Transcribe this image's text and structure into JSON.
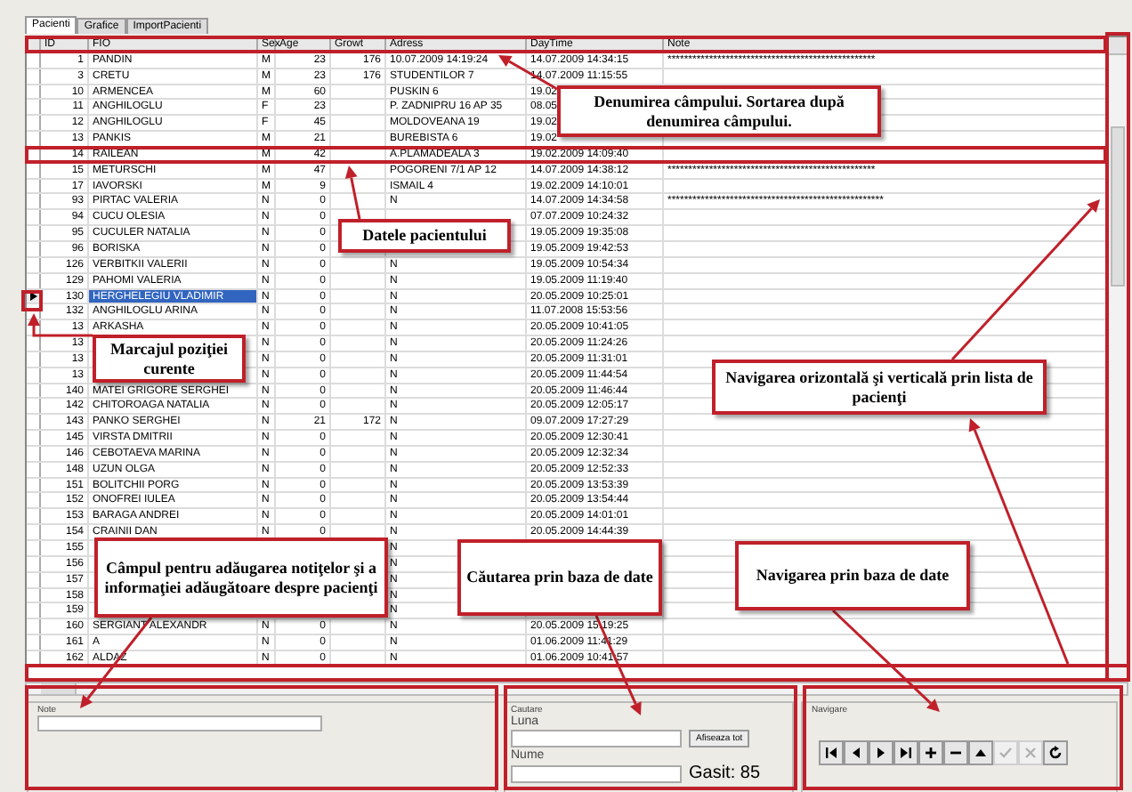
{
  "tabs": [
    {
      "label": "Pacienti",
      "selected": true
    },
    {
      "label": "Grafice",
      "selected": false
    },
    {
      "label": "ImportPacienti",
      "selected": false
    }
  ],
  "grid": {
    "columns": [
      "ID",
      "FIO",
      "Sex",
      "Age",
      "Growt",
      "Adress",
      "DayTime",
      "Note"
    ],
    "rows": [
      {
        "id": "1",
        "fio": "PANDIN",
        "sex": "M",
        "age": "23",
        "growth": "176",
        "address": "10.07.2009 14:19:24",
        "daytime": "14.07.2009 14:34:15",
        "note": "**************************************************",
        "selected": false,
        "current": false
      },
      {
        "id": "3",
        "fio": "CRETU",
        "sex": "M",
        "age": "23",
        "growth": "176",
        "address": "STUDENTILOR 7",
        "daytime": "14.07.2009 11:15:55",
        "selected": false,
        "current": false
      },
      {
        "id": "10",
        "fio": "ARMENCEA",
        "sex": "M",
        "age": "60",
        "address": "PUSKIN 6",
        "daytime": "19.02",
        "selected": false,
        "current": false
      },
      {
        "id": "11",
        "fio": "ANGHILOGLU",
        "sex": "F",
        "age": "23",
        "address": "P. ZADNIPRU 16 AP 35",
        "daytime": "08.05",
        "selected": false,
        "current": false
      },
      {
        "id": "12",
        "fio": "ANGHILOGLU",
        "sex": "F",
        "age": "45",
        "address": "MOLDOVEANA 19",
        "daytime": "19.02",
        "selected": false,
        "current": false
      },
      {
        "id": "13",
        "fio": "PANKIS",
        "sex": "M",
        "age": "21",
        "address": "BUREBISTA 6",
        "daytime": "19.02",
        "selected": false,
        "current": false
      },
      {
        "id": "14",
        "fio": "RAILEAN",
        "sex": "M",
        "age": "42",
        "address": "A.PLAMADEALA 3",
        "daytime": "19.02.2009 14:09:40",
        "selected": false,
        "current": false
      },
      {
        "id": "15",
        "fio": "METURSCHI",
        "sex": "M",
        "age": "47",
        "address": "POGORENI 7/1 AP 12",
        "daytime": "14.07.2009 14:38:12",
        "note": "**************************************************",
        "selected": false,
        "current": false
      },
      {
        "id": "17",
        "fio": "IAVORSKI",
        "sex": "M",
        "age": "9",
        "address": "ISMAIL 4",
        "daytime": "19.02.2009 14:10:01",
        "selected": false,
        "current": false
      },
      {
        "id": "93",
        "fio": "PIRTAC VALERIA",
        "sex": "N",
        "age": "0",
        "address": "N",
        "daytime": "14.07.2009 14:34:58",
        "note": "****************************************************",
        "selected": false,
        "current": false
      },
      {
        "id": "94",
        "fio": "CUCU OLESIA",
        "sex": "N",
        "age": "0",
        "daytime": "07.07.2009 10:24:32",
        "selected": false,
        "current": false
      },
      {
        "id": "95",
        "fio": "CUCULER NATALIA",
        "sex": "N",
        "age": "0",
        "daytime": "19.05.2009 19:35:08",
        "selected": false,
        "current": false
      },
      {
        "id": "96",
        "fio": "BORISKA",
        "sex": "N",
        "age": "0",
        "daytime": "19.05.2009 19:42:53",
        "selected": false,
        "current": false
      },
      {
        "id": "126",
        "fio": "VERBITKII VALERII",
        "sex": "N",
        "age": "0",
        "address": "N",
        "daytime": "19.05.2009 10:54:34",
        "selected": false,
        "current": false
      },
      {
        "id": "129",
        "fio": "PAHOMI VALERIA",
        "sex": "N",
        "age": "0",
        "address": "N",
        "daytime": "19.05.2009 11:19:40",
        "selected": false,
        "current": false
      },
      {
        "id": "130",
        "fio": "HERGHELEGIU VLADIMIR",
        "sex": "N",
        "age": "0",
        "address": "N",
        "daytime": "20.05.2009 10:25:01",
        "selected": true,
        "current": true
      },
      {
        "id": "132",
        "fio": "ANGHILOGLU ARINA",
        "sex": "N",
        "age": "0",
        "address": "N",
        "daytime": "11.07.2008 15:53:56",
        "selected": false,
        "current": false
      },
      {
        "id": "13",
        "fio": "ARKASHA",
        "sex": "N",
        "age": "0",
        "address": "N",
        "daytime": "20.05.2009 10:41:05",
        "selected": false,
        "current": false
      },
      {
        "id": "13",
        "sex": "N",
        "age": "0",
        "address": "N",
        "daytime": "20.05.2009 11:24:26",
        "selected": false,
        "current": false
      },
      {
        "id": "13",
        "sex": "N",
        "age": "0",
        "address": "N",
        "daytime": "20.05.2009 11:31:01",
        "selected": false,
        "current": false
      },
      {
        "id": "13",
        "sex": "N",
        "age": "0",
        "address": "N",
        "daytime": "20.05.2009 11:44:54",
        "selected": false,
        "current": false
      },
      {
        "id": "140",
        "fio": "MATEI GRIGORE SERGHEI",
        "sex": "N",
        "age": "0",
        "address": "N",
        "daytime": "20.05.2009 11:46:44",
        "selected": false,
        "current": false
      },
      {
        "id": "142",
        "fio": "CHITOROAGA NATALIA",
        "sex": "N",
        "age": "0",
        "address": "N",
        "daytime": "20.05.2009 12:05:17",
        "selected": false,
        "current": false
      },
      {
        "id": "143",
        "fio": "PANKO SERGHEI",
        "sex": "N",
        "age": "21",
        "growth": "172",
        "address": "N",
        "daytime": "09.07.2009 17:27:29",
        "selected": false,
        "current": false
      },
      {
        "id": "145",
        "fio": "VIRSTA DMITRII",
        "sex": "N",
        "age": "0",
        "address": "N",
        "daytime": "20.05.2009 12:30:41",
        "selected": false,
        "current": false
      },
      {
        "id": "146",
        "fio": "CEBOTAEVA MARINA",
        "sex": "N",
        "age": "0",
        "address": "N",
        "daytime": "20.05.2009 12:32:34",
        "selected": false,
        "current": false
      },
      {
        "id": "148",
        "fio": "UZUN OLGA",
        "sex": "N",
        "age": "0",
        "address": "N",
        "daytime": "20.05.2009 12:52:33",
        "selected": false,
        "current": false
      },
      {
        "id": "151",
        "fio": "BOLITCHII PORG",
        "sex": "N",
        "age": "0",
        "address": "N",
        "daytime": "20.05.2009 13:53:39",
        "selected": false,
        "current": false
      },
      {
        "id": "152",
        "fio": "ONOFREI IULEA",
        "sex": "N",
        "age": "0",
        "address": "N",
        "daytime": "20.05.2009 13:54:44",
        "selected": false,
        "current": false
      },
      {
        "id": "153",
        "fio": "BARAGA ANDREI",
        "sex": "N",
        "age": "0",
        "address": "N",
        "daytime": "20.05.2009 14:01:01",
        "selected": false,
        "current": false
      },
      {
        "id": "154",
        "fio": "CRAINII DAN",
        "sex": "N",
        "age": "0",
        "address": "N",
        "daytime": "20.05.2009 14:44:39",
        "selected": false,
        "current": false
      },
      {
        "id": "155",
        "address": "N",
        "selected": false,
        "current": false
      },
      {
        "id": "156",
        "address": "N",
        "selected": false,
        "current": false
      },
      {
        "id": "157",
        "address": "N",
        "selected": false,
        "current": false
      },
      {
        "id": "158",
        "address": "N",
        "selected": false,
        "current": false
      },
      {
        "id": "159",
        "address": "N",
        "selected": false,
        "current": false
      },
      {
        "id": "160",
        "fio": "SERGIANT ALEXANDR",
        "sex": "N",
        "age": "0",
        "address": "N",
        "daytime": "20.05.2009 15:19:25",
        "selected": false,
        "current": false
      },
      {
        "id": "161",
        "fio": "A",
        "sex": "N",
        "age": "0",
        "address": "N",
        "daytime": "01.06.2009 11:41:29",
        "selected": false,
        "current": false
      },
      {
        "id": "162",
        "fio": "ALDAZ",
        "sex": "N",
        "age": "0",
        "address": "N",
        "daytime": "01.06.2009 10:41:57",
        "selected": false,
        "current": false
      }
    ]
  },
  "note_panel": {
    "title": "Note"
  },
  "search_panel": {
    "title": "Cautare",
    "month_label": "Luna",
    "name_label": "Nume",
    "show_all_button": "Afiseaza tot",
    "found": "Gasit: 85"
  },
  "navigator": {
    "title": "Navigare",
    "buttons": [
      {
        "kind": "first",
        "disabled": false
      },
      {
        "kind": "prior",
        "disabled": false
      },
      {
        "kind": "next",
        "disabled": false
      },
      {
        "kind": "last",
        "disabled": false
      },
      {
        "kind": "insert",
        "disabled": false
      },
      {
        "kind": "delete",
        "disabled": false
      },
      {
        "kind": "edit",
        "disabled": false
      },
      {
        "kind": "post",
        "disabled": true
      },
      {
        "kind": "cancel",
        "disabled": true
      },
      {
        "kind": "refresh",
        "disabled": false
      }
    ]
  },
  "annotations": [
    {
      "text": "Denumirea câmpului. Sortarea după denumirea câmpului."
    },
    {
      "text": "Datele pacientului"
    },
    {
      "text": "Marcajul poziţiei curente"
    },
    {
      "text": "Navigarea orizontală şi verticală prin lista de pacienţi"
    },
    {
      "text": "Câmpul pentru adăugarea notiţelor şi a informaţiei adăugătoare despre pacienţi"
    },
    {
      "text": "Căutarea prin baza de date"
    },
    {
      "text": "Navigarea prin baza de date"
    }
  ]
}
